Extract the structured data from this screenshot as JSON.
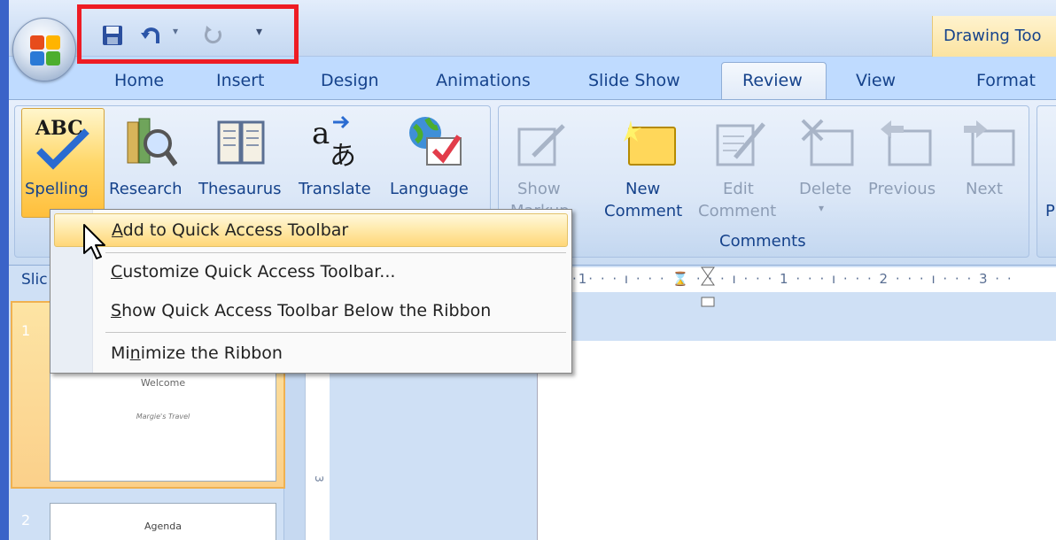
{
  "title_bar": {
    "context_tab_title": "Drawing Too"
  },
  "quick_access_toolbar": {
    "items": [
      "save-icon",
      "undo-icon",
      "redo-icon",
      "customize-dropdown-icon"
    ]
  },
  "tabs": [
    {
      "label": "Home"
    },
    {
      "label": "Insert"
    },
    {
      "label": "Design"
    },
    {
      "label": "Animations"
    },
    {
      "label": "Slide Show"
    },
    {
      "label": "Review"
    },
    {
      "label": "View"
    },
    {
      "label": "Format"
    }
  ],
  "active_tab": "Review",
  "ribbon": {
    "proofing": {
      "buttons": [
        {
          "label": "Spelling"
        },
        {
          "label": "Research"
        },
        {
          "label": "Thesaurus"
        },
        {
          "label": "Translate"
        },
        {
          "label": "Language"
        }
      ]
    },
    "comments": {
      "label": "Comments",
      "buttons": [
        {
          "line1": "Show",
          "line2": "Markup"
        },
        {
          "line1": "New",
          "line2": "Comment"
        },
        {
          "line1": "Edit",
          "line2": "Comment"
        },
        {
          "line1": "Delete",
          "line2": "▾"
        },
        {
          "line1": "Previous",
          "line2": ""
        },
        {
          "line1": "Next",
          "line2": ""
        }
      ]
    },
    "protect_partial": "P"
  },
  "context_menu": {
    "items": [
      {
        "label": "Add to Quick Access Toolbar",
        "accel_pre": "",
        "accel": "A",
        "accel_post": "dd to Quick Access Toolbar"
      },
      {
        "label": "Customize Quick Access Toolbar...",
        "accel_pre": "",
        "accel": "C",
        "accel_post": "ustomize Quick Access Toolbar..."
      },
      {
        "label": "Show Quick Access Toolbar Below the Ribbon",
        "accel_pre": "",
        "accel": "S",
        "accel_post": "how Quick Access Toolbar Below the Ribbon"
      },
      {
        "label": "Minimize the Ribbon",
        "accel_pre": "Mi",
        "accel": "n",
        "accel_post": "imize the Ribbon"
      }
    ]
  },
  "slides_pane": {
    "tab_label": "Slic",
    "slides": [
      {
        "number": "1",
        "title": "Welcome",
        "subtitle": "Margie's Travel"
      },
      {
        "number": "2",
        "title": "Agenda"
      }
    ]
  },
  "ruler": {
    "text": "·1· · · ı · · · ⌛ · · · ı · · · 1 · · · ı · · · 2 · · · ı · · · 3 · ·",
    "vertical_mark": "3"
  },
  "colors": {
    "highlight_box": "#ee1c24",
    "ribbon_text": "#15428b",
    "menu_highlight": "#ffe9a8"
  }
}
